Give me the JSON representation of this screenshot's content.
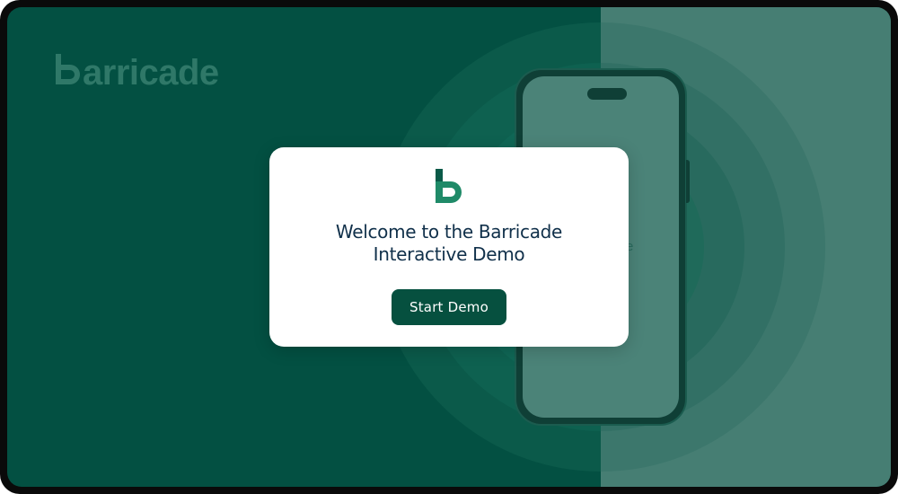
{
  "brand": {
    "logo_text": "barricade",
    "logo_word": "arricade",
    "logo_mark": "b-logo-icon"
  },
  "phone": {
    "glimpse_text": "e"
  },
  "modal": {
    "logo_icon": "barricade-b-icon",
    "title": "Welcome to the Barricade\nInteractive Demo",
    "start_button_label": "Start Demo"
  },
  "colors": {
    "background_dark": "#035042",
    "background_right": "#467e73",
    "accent_green": "#1f8a68",
    "button_bg": "#06503f",
    "title_text": "#10304a"
  }
}
